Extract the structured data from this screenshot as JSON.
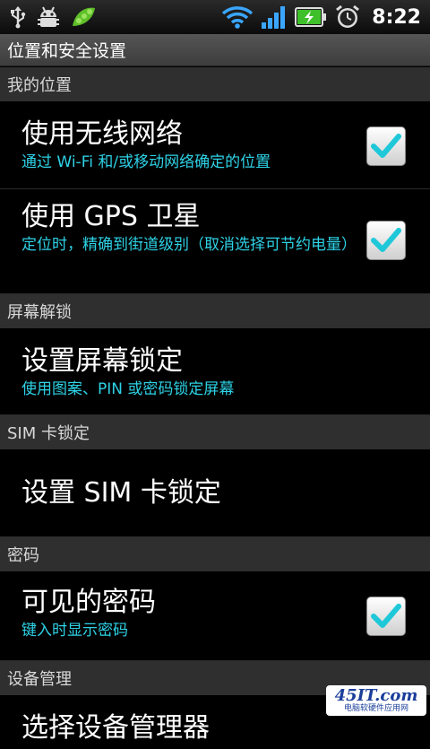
{
  "status_bar": {
    "icons_left": [
      "usb-icon",
      "android-debug-icon",
      "pea-pod-app-icon"
    ],
    "icons_right": [
      "wifi-icon",
      "signal-icon",
      "battery-charging-icon",
      "alarm-icon"
    ],
    "time": "8:22"
  },
  "title_bar": {
    "title": "位置和安全设置"
  },
  "sections": {
    "location": {
      "header": "我的位置",
      "wireless": {
        "title": "使用无线网络",
        "summary": "通过 Wi-Fi 和/或移动网络确定的位置",
        "checked": true
      },
      "gps": {
        "title": "使用 GPS 卫星",
        "summary": "定位时，精确到街道级别（取消选择可节约电量）",
        "checked": true
      }
    },
    "screen_unlock": {
      "header": "屏幕解锁",
      "set_lock": {
        "title": "设置屏幕锁定",
        "summary": "使用图案、PIN 或密码锁定屏幕"
      }
    },
    "sim_lock": {
      "header": "SIM 卡锁定",
      "set_sim": {
        "title": "设置 SIM 卡锁定"
      }
    },
    "password": {
      "header": "密码",
      "visible": {
        "title": "可见的密码",
        "summary": "键入时显示密码",
        "checked": true
      }
    },
    "device_admin": {
      "header": "设备管理",
      "partial_item": {
        "title": "选择设备管理器"
      }
    }
  },
  "watermark": {
    "logo": "45IT.com",
    "caption": "电脑软硬件应用网"
  },
  "colors": {
    "summary_text": "#2ed2e6",
    "check_mark": "#1fc8d8",
    "section_bg": "#2f2f2f"
  }
}
